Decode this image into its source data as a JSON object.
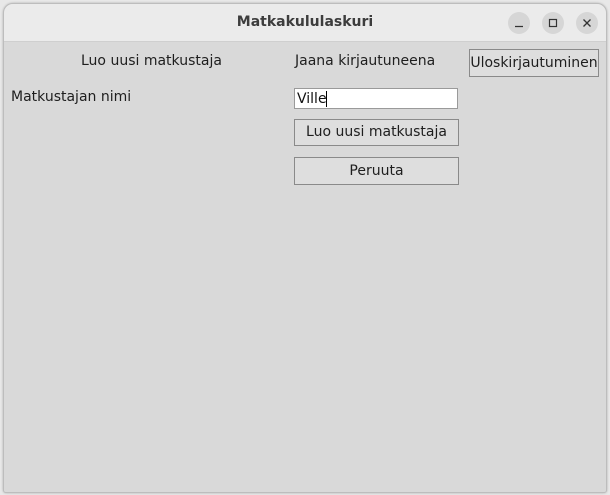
{
  "window": {
    "title": "Matkakululaskuri",
    "controls": [
      "minimize-icon",
      "maximize-icon",
      "close-icon"
    ]
  },
  "header": {
    "heading": "Luo uusi matkustaja",
    "user_status": "Jaana kirjautuneena",
    "logout_label": "Uloskirjautuminen"
  },
  "form": {
    "name_label": "Matkustajan nimi",
    "name_value": "Ville",
    "create_label": "Luo uusi matkustaja",
    "cancel_label": "Peruuta"
  },
  "colors": {
    "background": "#d9d9d9",
    "titlebar": "#ebebeb",
    "button": "#dedede"
  }
}
